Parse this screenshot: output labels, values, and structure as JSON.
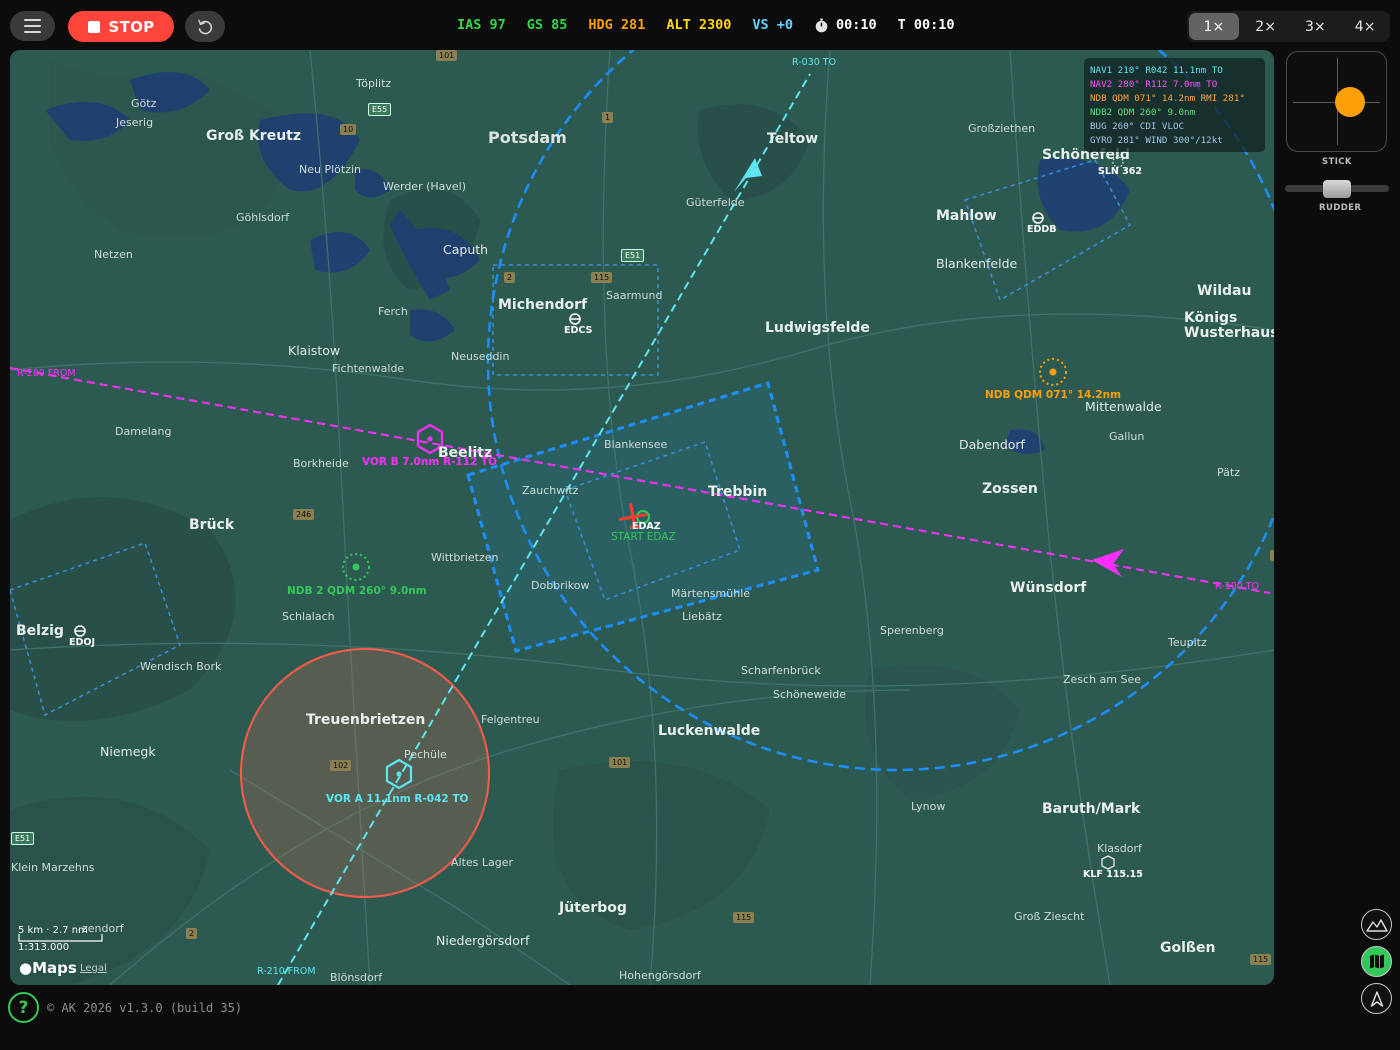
{
  "toolbar": {
    "stop_label": "STOP",
    "telemetry": [
      {
        "text": "IAS 97",
        "color": "#32d74b"
      },
      {
        "text": "GS 85",
        "color": "#32d74b"
      },
      {
        "text": "HDG 281",
        "color": "#ff9f0a"
      },
      {
        "text": "ALT 2300",
        "color": "#ffd60a"
      },
      {
        "text": "VS +0",
        "color": "#64d2ff"
      }
    ],
    "timer": "00:10",
    "total_time": "T 00:10",
    "speed_options": [
      "1×",
      "2×",
      "3×",
      "4×"
    ],
    "speed_selected": "1×"
  },
  "nav_info": [
    {
      "text": "NAV1 210° R042 11.1nm TO",
      "color": "#5ee6f0"
    },
    {
      "text": "NAV2 280° R112 7.0nm TO",
      "color": "#ff4fff"
    },
    {
      "text": "NDB  QDM 071° 14.2nm  RMI 281°",
      "color": "#ffa53a"
    },
    {
      "text": "NDB2 QDM 260° 9.0nm",
      "color": "#5ce07a"
    },
    {
      "text": "BUG 260°  CDI VLOC",
      "color": "#9fc6e8"
    },
    {
      "text": "GYRO 281°  WIND 300°/12kt",
      "color": "#9fc6e8"
    }
  ],
  "map": {
    "big_labels": [
      {
        "text": "Potsdam"
      }
    ],
    "cities": [
      {
        "text": "Groß Kreutz"
      },
      {
        "text": "Teltow"
      },
      {
        "text": "Ludwigsfelde"
      },
      {
        "text": "Trebbin"
      },
      {
        "text": "Beelitz"
      },
      {
        "text": "Treuenbrietzen"
      },
      {
        "text": "Luckenwalde"
      },
      {
        "text": "Jüterbog"
      },
      {
        "text": "Baruth/Mark"
      },
      {
        "text": "Zossen"
      },
      {
        "text": "Wünsdorf"
      },
      {
        "text": "Königs"
      },
      {
        "text": "Wusterhausen"
      },
      {
        "text": "Wildau"
      },
      {
        "text": "Mahlow"
      },
      {
        "text": "Schönefeld"
      },
      {
        "text": "Michendorf"
      },
      {
        "text": "Brück"
      },
      {
        "text": "Belzig"
      },
      {
        "text": "Golßen"
      }
    ],
    "towns": [
      {
        "text": "Töplitz"
      },
      {
        "text": "Götz"
      },
      {
        "text": "Jeserig"
      },
      {
        "text": "Neu Plötzin"
      },
      {
        "text": "Werder (Havel)"
      },
      {
        "text": "Göhlsdorf"
      },
      {
        "text": "Netzen"
      },
      {
        "text": "Caputh"
      },
      {
        "text": "Ferch"
      },
      {
        "text": "Klaistow"
      },
      {
        "text": "Fichtenwalde"
      },
      {
        "text": "Neuseddin"
      },
      {
        "text": "Saarmund"
      },
      {
        "text": "Güterfelde"
      },
      {
        "text": "Großziethen"
      },
      {
        "text": "Blankenfelde"
      },
      {
        "text": "Damelang"
      },
      {
        "text": "Borkheide"
      },
      {
        "text": "Blankensee"
      },
      {
        "text": "Zauchwitz"
      },
      {
        "text": "Dabendorf"
      },
      {
        "text": "Mittenwalde"
      },
      {
        "text": "Gallun"
      },
      {
        "text": "Pätz"
      },
      {
        "text": "Wittbrietzen"
      },
      {
        "text": "Dobbrikow"
      },
      {
        "text": "Märtensmühle"
      },
      {
        "text": "Liebätz"
      },
      {
        "text": "Sperenberg"
      },
      {
        "text": "Teupitz"
      },
      {
        "text": "Schlalach"
      },
      {
        "text": "Scharfenbrück"
      },
      {
        "text": "Schöneweide"
      },
      {
        "text": "Zesch am See"
      },
      {
        "text": "Felgentreu"
      },
      {
        "text": "Niemegk"
      },
      {
        "text": "Pechüle"
      },
      {
        "text": "Lynow"
      },
      {
        "text": "Klasdorf"
      },
      {
        "text": "Klein Marzehns"
      },
      {
        "text": "Altes Lager"
      },
      {
        "text": "Niedergörsdorf"
      },
      {
        "text": "Groß Ziescht"
      },
      {
        "text": "Blönsdorf"
      },
      {
        "text": "Hohengörsdorf"
      },
      {
        "text": "Wendisch Bork"
      },
      {
        "text": "zendorf"
      }
    ],
    "road_shields": [
      "101",
      "10",
      "E55",
      "1",
      "115",
      "E51",
      "2",
      "246",
      "102",
      "101",
      "115",
      "2",
      "115",
      "E51",
      "115"
    ],
    "airports": [
      {
        "code": "EDCS"
      },
      {
        "code": "EDDB"
      },
      {
        "code": "EDOJ"
      },
      {
        "code": "EDAZ"
      }
    ],
    "start_label": "START EDAZ",
    "vor_a_label": "VOR A  11.1nm  R-042  TO",
    "vor_b_label": "VOR B  7.0nm  R-112  TO",
    "ndb_label": "NDB  QDM 071°  14.2nm",
    "ndb2_label": "NDB 2  QDM 260°  9.0nm",
    "sln_label": "SLN 362",
    "klf_label": "KLF 115.15",
    "radial_labels": {
      "r030": "R-030 TO",
      "r210": "R-210 FROM",
      "r280": "R-280 FROM",
      "r100": "R-100 TO"
    },
    "scale_text": "5 km  ·  2.7 nm",
    "scale_ratio": "1:313.000",
    "maps_logo": "Maps",
    "legal": "Legal",
    "colors": {
      "vor_a": "#5ee6f0",
      "vor_b": "#ff2dff",
      "ndb": "#ff9f0a",
      "ndb2": "#34c759",
      "range_ring": "#1e8fff",
      "danger_zone": "#ff5a4a"
    }
  },
  "controls": {
    "stick_label": "STICK",
    "rudder_label": "RUDDER"
  },
  "footer": {
    "help": "?",
    "version": "© AK 2026   v1.3.0 (build 35)"
  }
}
